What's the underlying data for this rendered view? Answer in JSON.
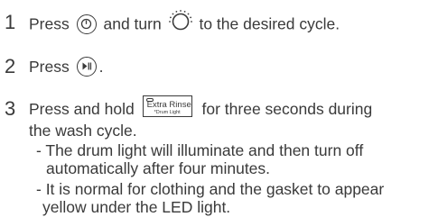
{
  "steps": [
    {
      "number": "1",
      "text_before": "Press",
      "icon1": "power-button-icon",
      "text_middle": "and turn",
      "icon2": "cycle-dial-icon",
      "text_after": "to the desired cycle."
    },
    {
      "number": "2",
      "text_before": "Press",
      "icon1": "start-pause-button-icon",
      "text_after": "."
    },
    {
      "number": "3",
      "text_before": "Press and hold",
      "button_main": "Extra Rinse",
      "button_sub": "*Drum Light",
      "text_after": "for three seconds during",
      "line2": "the wash cycle.",
      "notes": [
        {
          "line1": "- The drum light will illuminate and then turn off",
          "line2": "automatically after four minutes."
        },
        {
          "line1": "- It is normal for clothing and the gasket to appear",
          "line2": "yellow under the LED light."
        }
      ]
    }
  ]
}
